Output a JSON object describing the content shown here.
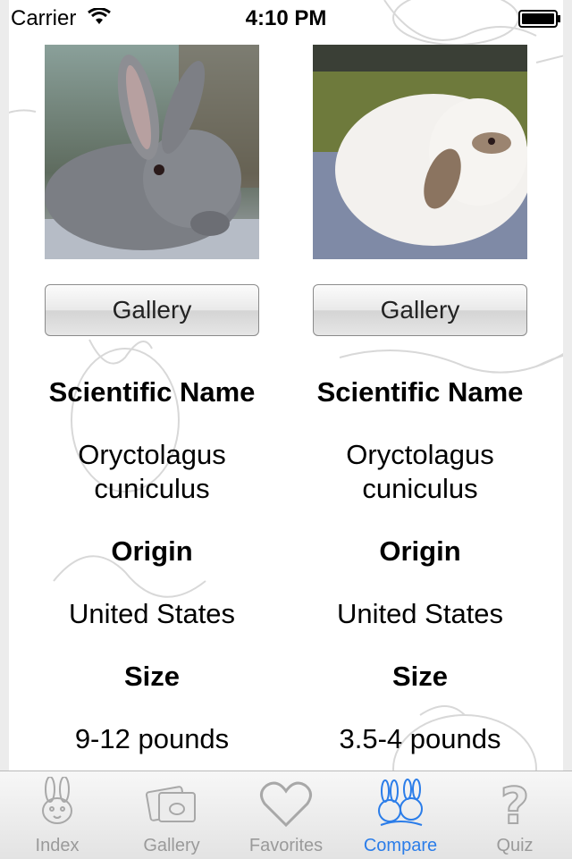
{
  "status_bar": {
    "carrier": "Carrier",
    "time": "4:10 PM"
  },
  "compare": {
    "left": {
      "photo": "rabbit-photo",
      "gallery_label": "Gallery",
      "scientific_name_label": "Scientific Name",
      "scientific_name_value": "Oryctolagus cuniculus",
      "origin_label": "Origin",
      "origin_value": "United States",
      "size_label": "Size",
      "size_value": "9-12 pounds"
    },
    "right": {
      "photo": "rabbit-photo",
      "gallery_label": "Gallery",
      "scientific_name_label": "Scientific Name",
      "scientific_name_value": "Oryctolagus cuniculus",
      "origin_label": "Origin",
      "origin_value": "United States",
      "size_label": "Size",
      "size_value": "3.5-4 pounds"
    }
  },
  "tab_bar": {
    "tabs": [
      {
        "label": "Index",
        "icon": "rabbit-icon"
      },
      {
        "label": "Gallery",
        "icon": "photos-icon"
      },
      {
        "label": "Favorites",
        "icon": "heart-icon"
      },
      {
        "label": "Compare",
        "icon": "two-rabbits-icon"
      },
      {
        "label": "Quiz",
        "icon": "question-icon"
      }
    ],
    "active": "Compare"
  },
  "colors": {
    "active_tab": "#2b7de9",
    "inactive_tab": "#9a9a9a"
  }
}
